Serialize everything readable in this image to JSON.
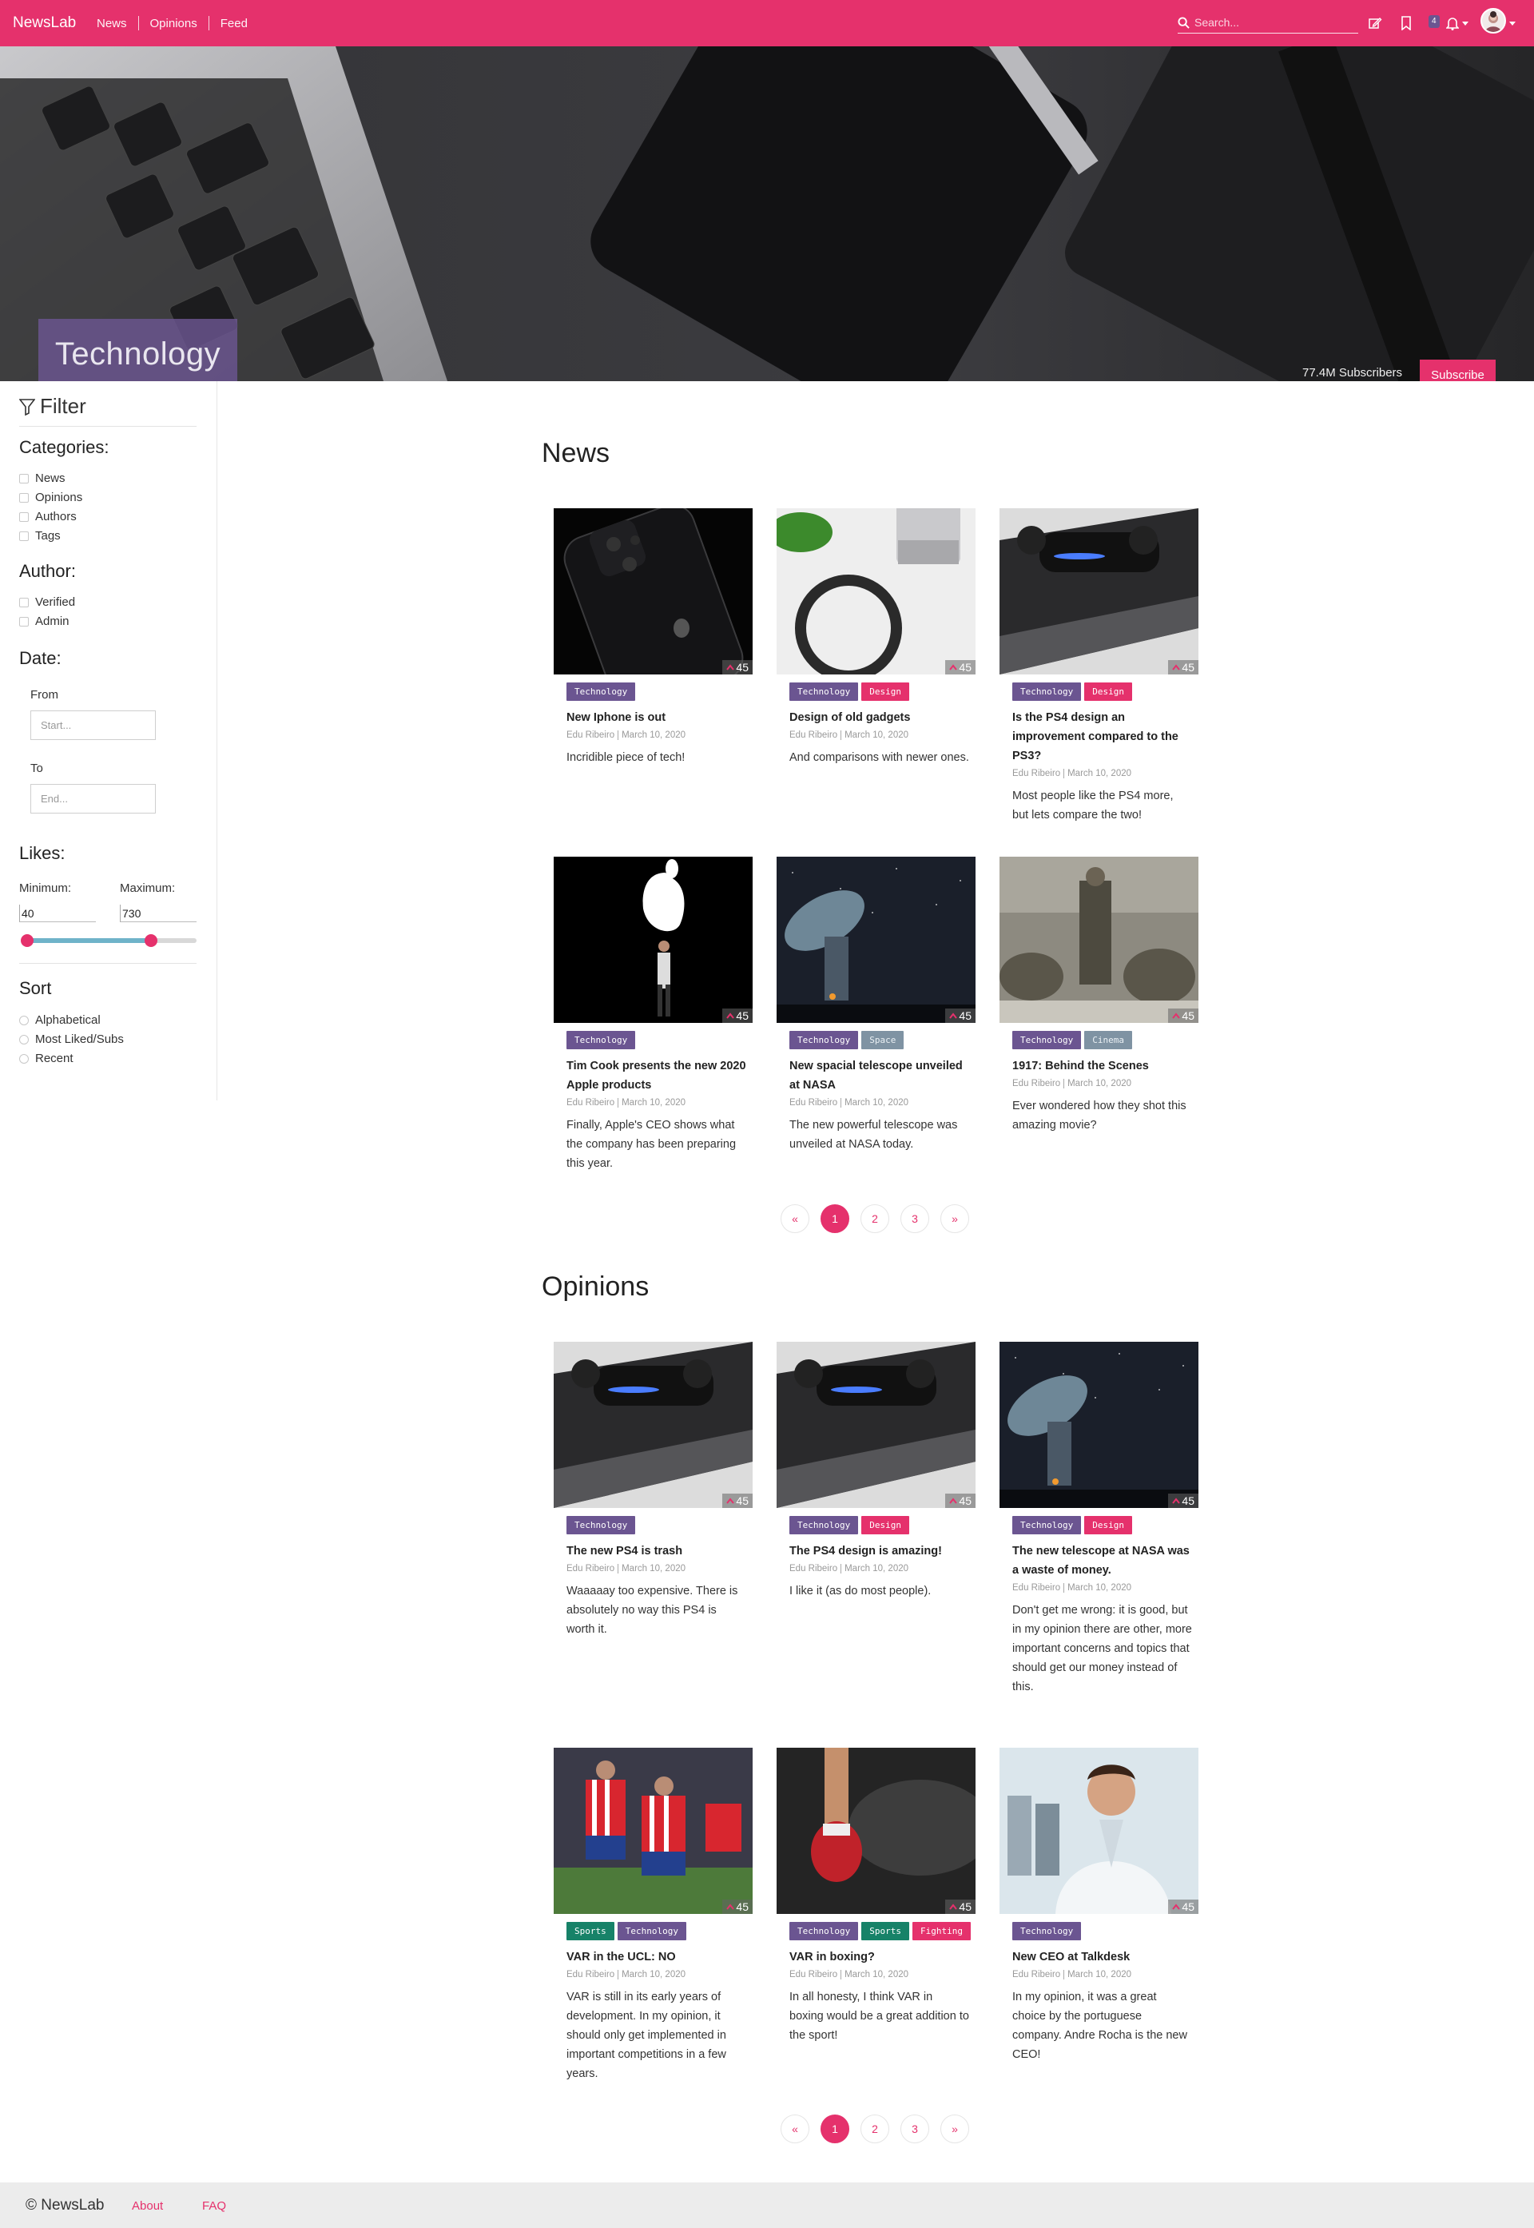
{
  "navbar": {
    "brand": "NewsLab",
    "links": [
      "News",
      "Opinions",
      "Feed"
    ],
    "search_placeholder": "Search...",
    "notification_count": "4",
    "icons": [
      "search-icon",
      "edit-icon",
      "bookmark-icon",
      "bell-icon",
      "avatar"
    ]
  },
  "hero": {
    "title": "Technology",
    "subscribers": "77.4M Subscribers",
    "subscribe_label": "Subscribe"
  },
  "sidebar": {
    "filter_title": "Filter",
    "categories_title": "Categories:",
    "categories": [
      "News",
      "Opinions",
      "Authors",
      "Tags"
    ],
    "author_title": "Author:",
    "authors": [
      "Verified",
      "Admin"
    ],
    "date_title": "Date:",
    "from_label": "From",
    "from_placeholder": "Start...",
    "to_label": "To",
    "to_placeholder": "End...",
    "likes_title": "Likes:",
    "min_label": "Minimum:",
    "max_label": "Maximum:",
    "min_value": "40",
    "max_value": "730",
    "sort_title": "Sort",
    "sort_options": [
      "Alphabetical",
      "Most Liked/Subs",
      "Recent"
    ]
  },
  "news": {
    "title": "News",
    "cards": [
      {
        "tags": [
          "Technology"
        ],
        "title": "New Iphone is out",
        "author": "Edu Ribeiro",
        "date": "March 10, 2020",
        "desc": "Incridible piece of tech!",
        "likes": "45"
      },
      {
        "tags": [
          "Technology",
          "Design"
        ],
        "title": "Design of old gadgets",
        "author": "Edu Ribeiro",
        "date": "March 10, 2020",
        "desc": "And comparisons with newer ones.",
        "likes": "45"
      },
      {
        "tags": [
          "Technology",
          "Design"
        ],
        "title": "Is the PS4 design an improvement compared to the PS3?",
        "author": "Edu Ribeiro",
        "date": "March 10, 2020",
        "desc": "Most people like the PS4 more, but lets compare the two!",
        "likes": "45"
      },
      {
        "tags": [
          "Technology"
        ],
        "title": "Tim Cook presents the new 2020 Apple products",
        "author": "Edu Ribeiro",
        "date": "March 10, 2020",
        "desc": "Finally, Apple's CEO shows what the company has been preparing this year.",
        "likes": "45"
      },
      {
        "tags": [
          "Technology",
          "Space"
        ],
        "title": "New spacial telescope unveiled at NASA",
        "author": "Edu Ribeiro",
        "date": "March 10, 2020",
        "desc": "The new powerful telescope was unveiled at NASA today.",
        "likes": "45"
      },
      {
        "tags": [
          "Technology",
          "Cinema"
        ],
        "title": "1917: Behind the Scenes",
        "author": "Edu Ribeiro",
        "date": "March 10, 2020",
        "desc": "Ever wondered how they shot this amazing movie?",
        "likes": "45"
      }
    ],
    "pages": [
      "«",
      "1",
      "2",
      "3",
      "»"
    ]
  },
  "opinions": {
    "title": "Opinions",
    "cards": [
      {
        "tags": [
          "Technology"
        ],
        "title": "The new PS4 is trash",
        "author": "Edu Ribeiro",
        "date": "March 10, 2020",
        "desc": "Waaaaay too expensive. There is absolutely no way this PS4 is worth it.",
        "likes": "45"
      },
      {
        "tags": [
          "Technology",
          "Design"
        ],
        "title": "The PS4 design is amazing!",
        "author": "Edu Ribeiro",
        "date": "March 10, 2020",
        "desc": "I like it (as do most people).",
        "likes": "45"
      },
      {
        "tags": [
          "Technology",
          "Design"
        ],
        "title": "The new telescope at NASA was a waste of money.",
        "author": "Edu Ribeiro",
        "date": "March 10, 2020",
        "desc": "Don't get me wrong: it is good, but in my opinion there are other, more important concerns and topics that should get our money instead of this.",
        "likes": "45"
      },
      {
        "tags": [
          "Sports",
          "Technology"
        ],
        "title": "VAR in the UCL: NO",
        "author": "Edu Ribeiro",
        "date": "March 10, 2020",
        "desc": "VAR is still in its early years of development. In my opinion, it should only get implemented in important competitions in a few years.",
        "likes": "45"
      },
      {
        "tags": [
          "Technology",
          "Sports",
          "Fighting"
        ],
        "title": "VAR in boxing?",
        "author": "Edu Ribeiro",
        "date": "March 10, 2020",
        "desc": "In all honesty, I think VAR in boxing would be a great addition to the sport!",
        "likes": "45"
      },
      {
        "tags": [
          "Technology"
        ],
        "title": "New CEO at Talkdesk",
        "author": "Edu Ribeiro",
        "date": "March 10, 2020",
        "desc": "In my opinion, it was a great choice by the portuguese company. Andre Rocha is the new CEO!",
        "likes": "45"
      }
    ],
    "pages": [
      "«",
      "1",
      "2",
      "3",
      "»"
    ]
  },
  "footer": {
    "copyright": "© NewsLab",
    "links": [
      "About",
      "FAQ"
    ]
  },
  "colors": {
    "accent": "#e5316c",
    "purple": "#6b5591",
    "green": "#178268",
    "slate": "#7f93a3"
  }
}
